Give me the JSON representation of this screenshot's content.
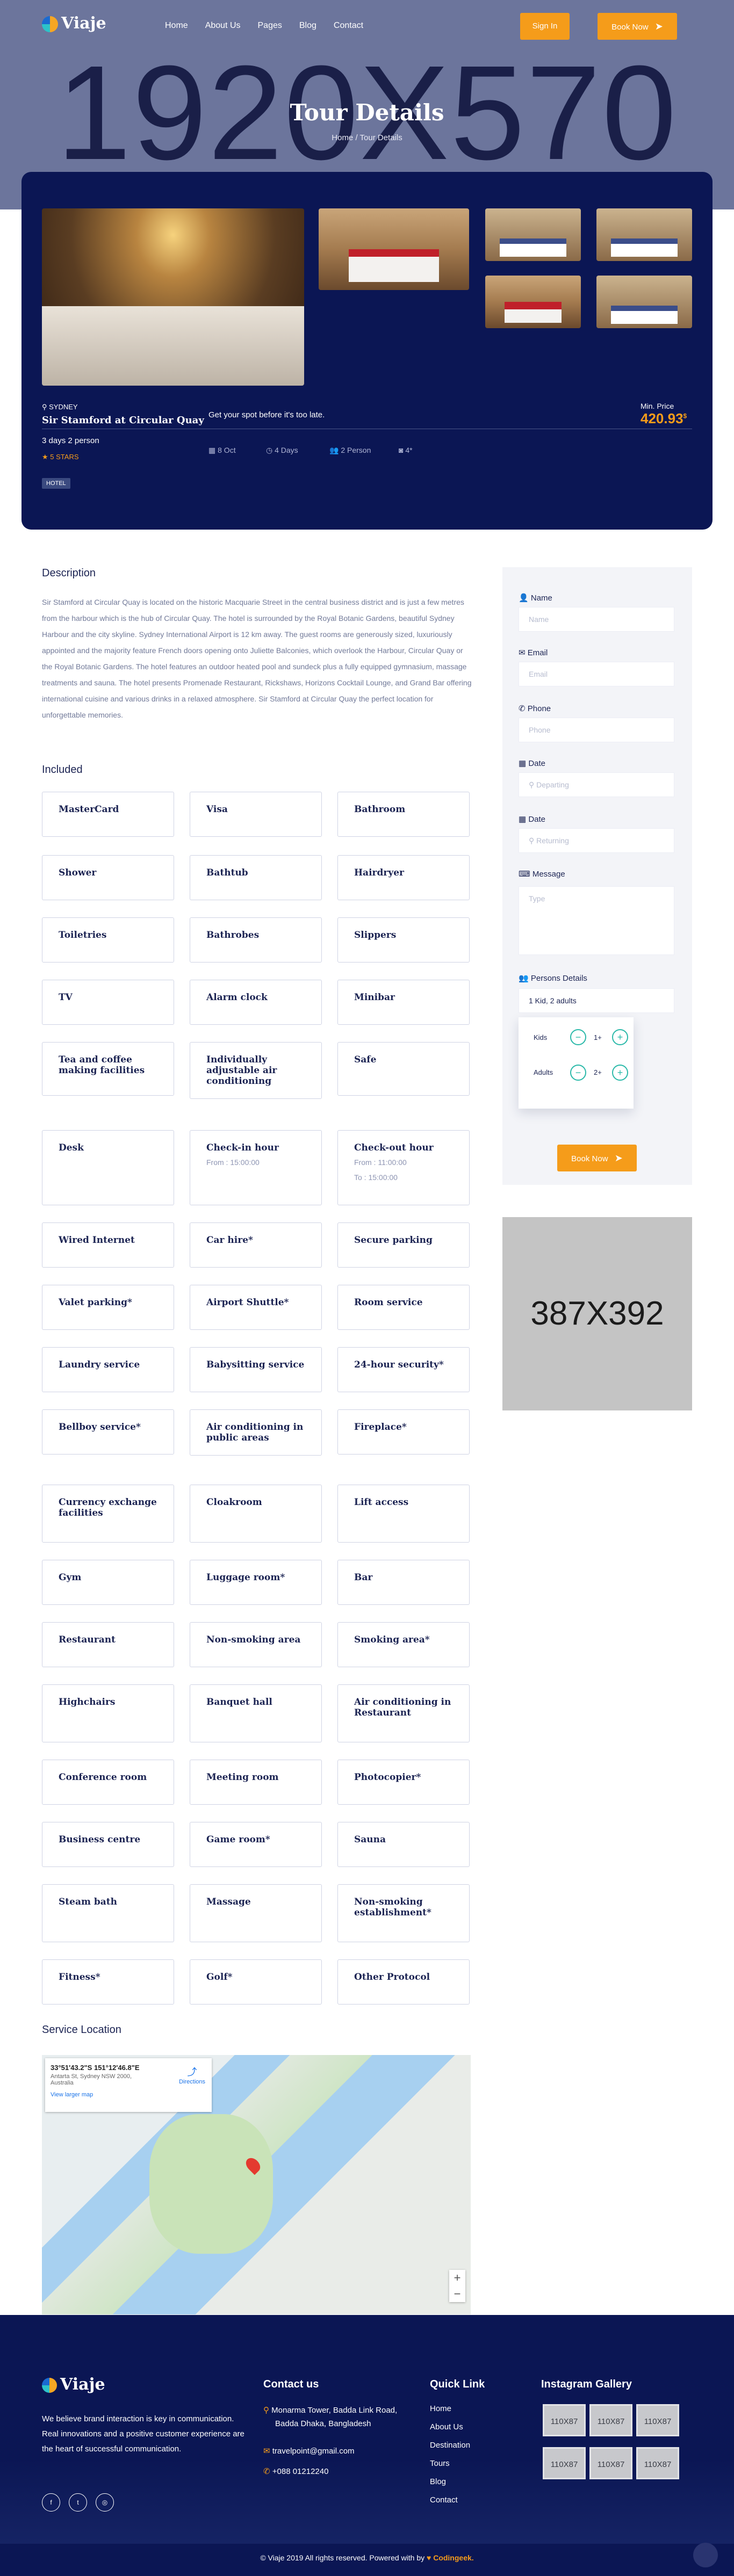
{
  "nav": {
    "logo": "Viaje",
    "menu": [
      "Home",
      "About Us",
      "Pages",
      "Blog",
      "Contact"
    ],
    "signin": "Sign In",
    "booknow": "Book Now"
  },
  "hero": {
    "placeholder": "1920X570",
    "title": "Tour Details",
    "breadcrumb": "Home / Tour Details"
  },
  "tour": {
    "location": "SYDNEY",
    "name": "Sir Stamford at Circular Quay",
    "duration": "3 days 2 person",
    "stars": "5 STARS",
    "tag": "HOTEL",
    "tagline": "Get your spot before it's too late.",
    "date": "8 Oct",
    "days": "4 Days",
    "persons": "2 Person",
    "photos": "4*",
    "price_label": "Min. Price",
    "price": "420.93",
    "currency": "$"
  },
  "description": {
    "heading": "Description",
    "text": "Sir Stamford at Circular Quay is located on the historic Macquarie Street in the central business district and is just a few metres from the harbour which is the hub of Circular Quay. The hotel is surrounded by the Royal Botanic Gardens, beautiful Sydney Harbour and the city skyline. Sydney International Airport is 12 km away. The guest rooms are generously sized, luxuriously appointed and the majority feature French doors opening onto Juliette Balconies, which overlook the Harbour, Circular Quay or the Royal Botanic Gardens. The hotel features an outdoor heated pool and sundeck plus a fully equipped gymnasium, massage treatments and sauna. The hotel presents Promenade Restaurant, Rickshaws, Horizons Cocktail Lounge, and Grand Bar offering international cuisine and various drinks in a relaxed atmosphere. Sir Stamford at Circular Quay the perfect location for unforgettable memories."
  },
  "included": {
    "heading": "Included",
    "items": [
      {
        "t": "MasterCard"
      },
      {
        "t": "Visa"
      },
      {
        "t": "Bathroom"
      },
      {
        "t": "Shower"
      },
      {
        "t": "Bathtub"
      },
      {
        "t": "Hairdryer"
      },
      {
        "t": "Toiletries"
      },
      {
        "t": "Bathrobes"
      },
      {
        "t": "Slippers"
      },
      {
        "t": "TV"
      },
      {
        "t": "Alarm clock"
      },
      {
        "t": "Minibar"
      },
      {
        "t": "Tea and coffee making facilities"
      },
      {
        "t": "Individually adjustable air conditioning"
      },
      {
        "t": "Safe"
      },
      {
        "t": "Desk"
      },
      {
        "t": "Check-in hour",
        "s1": "From : 15:00:00"
      },
      {
        "t": "Check-out hour",
        "s1": "From : 11:00:00",
        "s2": "To : 15:00:00"
      },
      {
        "t": "Wired Internet"
      },
      {
        "t": "Car hire*"
      },
      {
        "t": "Secure parking"
      },
      {
        "t": "Valet parking*"
      },
      {
        "t": "Airport Shuttle*"
      },
      {
        "t": "Room service"
      },
      {
        "t": "Laundry service"
      },
      {
        "t": "Babysitting service"
      },
      {
        "t": "24-hour security*"
      },
      {
        "t": "Bellboy service*"
      },
      {
        "t": "Air conditioning in public areas"
      },
      {
        "t": "Fireplace*"
      },
      {
        "t": "Currency exchange facilities"
      },
      {
        "t": "Cloakroom"
      },
      {
        "t": "Lift access"
      },
      {
        "t": "Gym"
      },
      {
        "t": "Luggage room*"
      },
      {
        "t": "Bar"
      },
      {
        "t": "Restaurant"
      },
      {
        "t": "Non-smoking area"
      },
      {
        "t": "Smoking area*"
      },
      {
        "t": "Highchairs"
      },
      {
        "t": "Banquet hall"
      },
      {
        "t": "Air conditioning in Restaurant"
      },
      {
        "t": "Conference room"
      },
      {
        "t": "Meeting room"
      },
      {
        "t": "Photocopier*"
      },
      {
        "t": "Business centre"
      },
      {
        "t": "Game room*"
      },
      {
        "t": "Sauna"
      },
      {
        "t": "Steam bath"
      },
      {
        "t": "Massage"
      },
      {
        "t": "Non-smoking establishment*"
      },
      {
        "t": "Fitness*"
      },
      {
        "t": "Golf*"
      },
      {
        "t": "Other Protocol"
      }
    ]
  },
  "location": {
    "heading": "Service Location",
    "coords": "33°51'43.2\"S 151°12'46.8\"E",
    "address": "Antarta St, Sydney NSW 2000, Australia",
    "larger": "View larger map",
    "directions": "Directions"
  },
  "form": {
    "name_label": "Name",
    "name_ph": "Name",
    "email_label": "Email",
    "email_ph": "Email",
    "phone_label": "Phone",
    "phone_ph": "Phone",
    "date1_label": "Date",
    "date1_ph": "Departing",
    "date2_label": "Date",
    "date2_ph": "Returning",
    "msg_label": "Message",
    "msg_ph": "Type",
    "persons_label": "Persons Details",
    "persons_value": "1 Kid, 2 adults",
    "kids_label": "Kids",
    "kids_value": "1+",
    "adults_label": "Adults",
    "adults_value": "2+",
    "submit": "Book Now"
  },
  "ad": {
    "placeholder": "387X392"
  },
  "footer": {
    "logo": "Viaje",
    "about": "We believe brand interaction is key in communication. Real innovations and a positive customer experience are the heart of successful communication.",
    "contact_heading": "Contact us",
    "address1": "Monarma Tower, Badda Link Road,",
    "address2": "Badda Dhaka, Bangladesh",
    "email": "travelpoint@gmail.com",
    "phone": "+088 01212240",
    "quick_heading": "Quick Link",
    "links": [
      "Home",
      "About Us",
      "Destination",
      "Tours",
      "Blog",
      "Contact"
    ],
    "gallery_heading": "Instagram Gallery",
    "gallery": [
      "110X87",
      "110X87",
      "110X87",
      "110X87",
      "110X87",
      "110X87"
    ],
    "copyright": "© Viaje 2019 All rights reserved. Powered with by",
    "brand": "Codingeek."
  }
}
